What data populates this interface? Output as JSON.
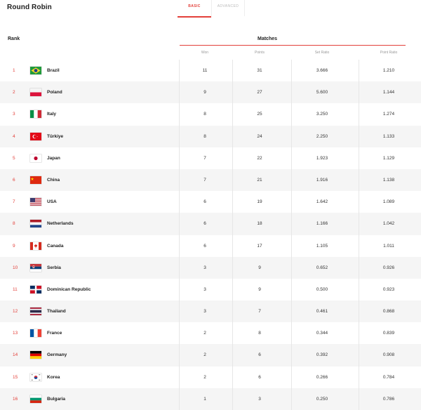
{
  "header": {
    "title": "Round Robin"
  },
  "tabs": {
    "basic": "BASIC",
    "advanced": "ADVANCED"
  },
  "table": {
    "rank_label": "Rank",
    "matches_label": "Matches",
    "columns": [
      "Won",
      "Points",
      "Set Ratio",
      "Point Ratio"
    ],
    "accent_color": "#e3403a",
    "rows": [
      {
        "rank": "1",
        "flag": "brazil-flag-icon",
        "country": "Brazil",
        "won": "11",
        "points": "31",
        "set_ratio": "3.666",
        "point_ratio": "1.210"
      },
      {
        "rank": "2",
        "flag": "poland-flag-icon",
        "country": "Poland",
        "won": "9",
        "points": "27",
        "set_ratio": "5.600",
        "point_ratio": "1.144"
      },
      {
        "rank": "3",
        "flag": "italy-flag-icon",
        "country": "Italy",
        "won": "8",
        "points": "25",
        "set_ratio": "3.250",
        "point_ratio": "1.274"
      },
      {
        "rank": "4",
        "flag": "turkiye-flag-icon",
        "country": "Türkiye",
        "won": "8",
        "points": "24",
        "set_ratio": "2.250",
        "point_ratio": "1.133"
      },
      {
        "rank": "5",
        "flag": "japan-flag-icon",
        "country": "Japan",
        "won": "7",
        "points": "22",
        "set_ratio": "1.923",
        "point_ratio": "1.129"
      },
      {
        "rank": "6",
        "flag": "china-flag-icon",
        "country": "China",
        "won": "7",
        "points": "21",
        "set_ratio": "1.916",
        "point_ratio": "1.138"
      },
      {
        "rank": "7",
        "flag": "usa-flag-icon",
        "country": "USA",
        "won": "6",
        "points": "19",
        "set_ratio": "1.642",
        "point_ratio": "1.089"
      },
      {
        "rank": "8",
        "flag": "netherlands-flag-icon",
        "country": "Netherlands",
        "won": "6",
        "points": "18",
        "set_ratio": "1.166",
        "point_ratio": "1.042"
      },
      {
        "rank": "9",
        "flag": "canada-flag-icon",
        "country": "Canada",
        "won": "6",
        "points": "17",
        "set_ratio": "1.105",
        "point_ratio": "1.011"
      },
      {
        "rank": "10",
        "flag": "serbia-flag-icon",
        "country": "Serbia",
        "won": "3",
        "points": "9",
        "set_ratio": "0.652",
        "point_ratio": "0.926"
      },
      {
        "rank": "11",
        "flag": "dominican-republic-flag-icon",
        "country": "Dominican Republic",
        "won": "3",
        "points": "9",
        "set_ratio": "0.500",
        "point_ratio": "0.923"
      },
      {
        "rank": "12",
        "flag": "thailand-flag-icon",
        "country": "Thailand",
        "won": "3",
        "points": "7",
        "set_ratio": "0.461",
        "point_ratio": "0.868"
      },
      {
        "rank": "13",
        "flag": "france-flag-icon",
        "country": "France",
        "won": "2",
        "points": "8",
        "set_ratio": "0.344",
        "point_ratio": "0.839"
      },
      {
        "rank": "14",
        "flag": "germany-flag-icon",
        "country": "Germany",
        "won": "2",
        "points": "6",
        "set_ratio": "0.392",
        "point_ratio": "0.908"
      },
      {
        "rank": "15",
        "flag": "korea-flag-icon",
        "country": "Korea",
        "won": "2",
        "points": "6",
        "set_ratio": "0.266",
        "point_ratio": "0.784"
      },
      {
        "rank": "16",
        "flag": "bulgaria-flag-icon",
        "country": "Bulgaria",
        "won": "1",
        "points": "3",
        "set_ratio": "0.250",
        "point_ratio": "0.786"
      }
    ]
  }
}
